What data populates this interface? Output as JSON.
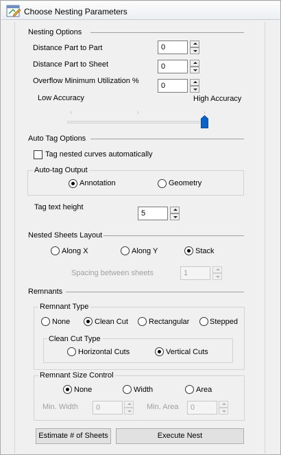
{
  "window": {
    "title": "Choose Nesting Parameters"
  },
  "nesting_options": {
    "header": "Nesting Options",
    "part_to_part": {
      "label": "Distance Part to Part",
      "value": "0"
    },
    "part_to_sheet": {
      "label": "Distance Part to Sheet",
      "value": "0"
    },
    "overflow_util": {
      "label": "Overflow Minimum Utilization %",
      "value": "0"
    },
    "accuracy": {
      "low_label": "Low Accuracy",
      "high_label": "High Accuracy",
      "level": 1.0
    }
  },
  "auto_tag": {
    "header": "Auto Tag Options",
    "tag_checkbox_label": "Tag nested curves automatically",
    "tag_checked": false,
    "output_group": "Auto-tag Output",
    "output_options": [
      "Annotation",
      "Geometry"
    ],
    "output_selected": "Annotation",
    "text_height_label": "Tag text height",
    "text_height_value": "5"
  },
  "nested_sheets": {
    "header": "Nested Sheets Layout",
    "options": [
      "Along X",
      "Along Y",
      "Stack"
    ],
    "selected": "Stack",
    "spacing_label": "Spacing between sheets",
    "spacing_value": "1"
  },
  "remnants": {
    "header": "Remnants",
    "type_group": "Remnant Type",
    "type_options": [
      "None",
      "Clean Cut",
      "Rectangular",
      "Stepped"
    ],
    "type_selected": "Clean Cut",
    "clean_cut_group": "Clean Cut Type",
    "clean_cut_options": [
      "Horizontal Cuts",
      "Vertical Cuts"
    ],
    "clean_cut_selected": "Vertical Cuts",
    "size_group": "Remnant Size Control",
    "size_options": [
      "None",
      "Width",
      "Area"
    ],
    "size_selected": "None",
    "min_width_label": "Min. Width",
    "min_width_value": "0",
    "min_area_label": "Min. Area",
    "min_area_value": "0"
  },
  "buttons": {
    "estimate": "Estimate # of Sheets",
    "execute": "Execute Nest"
  },
  "icons": {
    "app_icon": "nesting-app-icon"
  }
}
